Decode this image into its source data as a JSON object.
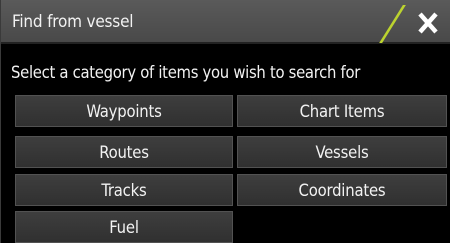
{
  "dialog": {
    "title": "Find from vessel",
    "prompt": "Select a category of items you wish to search for"
  },
  "categories": {
    "waypoints": "Waypoints",
    "chart_items": "Chart Items",
    "routes": "Routes",
    "vessels": "Vessels",
    "tracks": "Tracks",
    "coordinates": "Coordinates",
    "fuel": "Fuel"
  },
  "colors": {
    "accent": "#bcd32f",
    "title_bar": "#4f4f4f",
    "button": "#363636",
    "background": "#000000",
    "text": "#f2f2f2"
  },
  "icons": {
    "close": "close-icon"
  }
}
